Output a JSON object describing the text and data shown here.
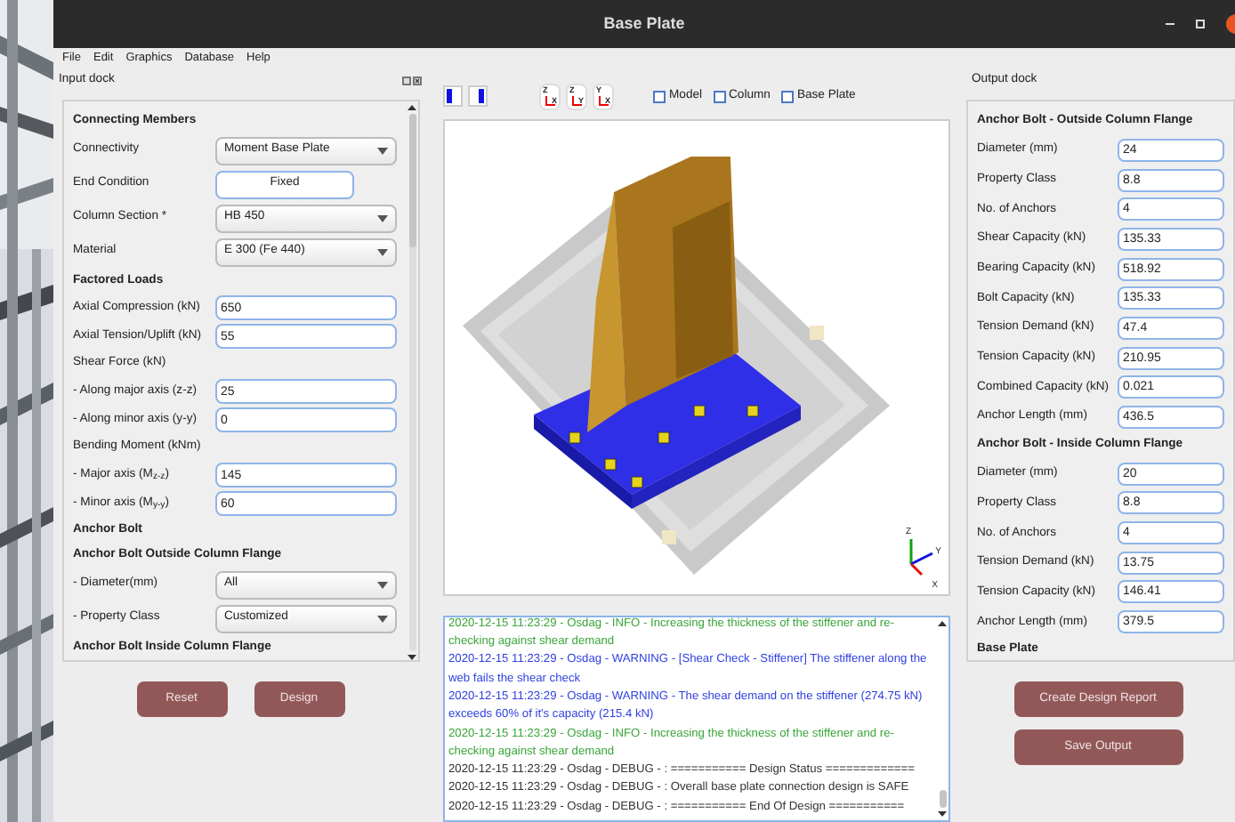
{
  "window": {
    "title": "Base Plate"
  },
  "menu": [
    "File",
    "Edit",
    "Graphics",
    "Database",
    "Help"
  ],
  "input_dock": {
    "title": "Input dock",
    "rows": [
      {
        "kind": "header",
        "label": "Connecting Members"
      },
      {
        "kind": "select",
        "label": "Connectivity",
        "value": "Moment Base Plate"
      },
      {
        "kind": "button",
        "label": "End Condition",
        "value": "Fixed"
      },
      {
        "kind": "select",
        "label": "Column Section *",
        "value": "HB 450"
      },
      {
        "kind": "select",
        "label": "Material",
        "value": "E 300 (Fe 440)"
      },
      {
        "kind": "header",
        "label": "Factored Loads"
      },
      {
        "kind": "input",
        "label": "Axial Compression (kN)",
        "value": "650"
      },
      {
        "kind": "input",
        "label": "Axial Tension/Uplift (kN)",
        "value": "55"
      },
      {
        "kind": "label",
        "label": "Shear Force (kN)"
      },
      {
        "kind": "input",
        "label": "- Along major axis (z-z)",
        "value": "25"
      },
      {
        "kind": "input",
        "label": "- Along minor axis (y-y)",
        "value": "0"
      },
      {
        "kind": "label",
        "label": "Bending Moment (kNm)"
      },
      {
        "kind": "input",
        "label": "- Major axis (M$_{z-z}$)",
        "value": "145"
      },
      {
        "kind": "input",
        "label": "- Minor axis (M$_{y-y}$)",
        "value": "60"
      },
      {
        "kind": "header",
        "label": "Anchor Bolt"
      },
      {
        "kind": "header",
        "label": "Anchor Bolt Outside Column Flange"
      },
      {
        "kind": "select",
        "label": "- Diameter(mm)",
        "value": "All"
      },
      {
        "kind": "select",
        "label": "- Property Class",
        "value": "Customized"
      },
      {
        "kind": "header",
        "label": "Anchor Bolt Inside Column Flange"
      }
    ],
    "buttons": [
      "Reset",
      "Design"
    ]
  },
  "toolbar": {
    "axis_views": [
      {
        "up": "Z",
        "right": "X"
      },
      {
        "up": "Z",
        "right": "Y"
      },
      {
        "up": "Y",
        "right": "X"
      }
    ],
    "checkboxes": [
      {
        "label": "Model",
        "checked": false
      },
      {
        "label": "Column",
        "checked": false
      },
      {
        "label": "Base Plate",
        "checked": false
      }
    ]
  },
  "axis_triad": {
    "z": "Z",
    "y": "Y",
    "x": "X"
  },
  "log": [
    {
      "kind": "info",
      "text": "2020-12-15 11:23:29 - Osdag - INFO - Increasing the thickness of the stiffener and re-checking against shear demand"
    },
    {
      "kind": "warning",
      "text": "2020-12-15 11:23:29 - Osdag - WARNING - [Shear Check - Stiffener] The stiffener along the web fails the shear check"
    },
    {
      "kind": "warning",
      "text": "2020-12-15 11:23:29 - Osdag - WARNING - The shear demand on the stiffener (274.75 kN) exceeds 60% of it's capacity (215.4 kN)"
    },
    {
      "kind": "info",
      "text": "2020-12-15 11:23:29 - Osdag - INFO - Increasing the thickness of the stiffener and re-checking against shear demand"
    },
    {
      "kind": "debug",
      "text": "2020-12-15 11:23:29 - Osdag - DEBUG - : =========== Design Status ============="
    },
    {
      "kind": "debug",
      "text": "2020-12-15 11:23:29 - Osdag - DEBUG - :       Overall base plate connection design is SAFE"
    },
    {
      "kind": "debug",
      "text": "2020-12-15 11:23:29 - Osdag - DEBUG - : =========== End Of Design ==========="
    }
  ],
  "output_dock": {
    "title": "Output dock",
    "rows": [
      {
        "kind": "header",
        "label": "Anchor Bolt - Outside Column Flange"
      },
      {
        "kind": "output",
        "label": "Diameter (mm)",
        "value": "24"
      },
      {
        "kind": "output",
        "label": "Property Class",
        "value": "8.8"
      },
      {
        "kind": "output",
        "label": "No. of Anchors",
        "value": "4"
      },
      {
        "kind": "output",
        "label": "Shear Capacity (kN)",
        "value": "135.33"
      },
      {
        "kind": "output",
        "label": "Bearing Capacity (kN)",
        "value": "518.92"
      },
      {
        "kind": "output",
        "label": "Bolt Capacity (kN)",
        "value": "135.33"
      },
      {
        "kind": "output",
        "label": "Tension Demand (kN)",
        "value": "47.4"
      },
      {
        "kind": "output",
        "label": "Tension Capacity (kN)",
        "value": "210.95"
      },
      {
        "kind": "output",
        "label": "Combined Capacity (kN)",
        "value": "0.021"
      },
      {
        "kind": "output",
        "label": "Anchor Length (mm)",
        "value": "436.5"
      },
      {
        "kind": "header",
        "label": "Anchor Bolt - Inside Column Flange"
      },
      {
        "kind": "output",
        "label": "Diameter (mm)",
        "value": "20"
      },
      {
        "kind": "output",
        "label": "Property Class",
        "value": "8.8"
      },
      {
        "kind": "output",
        "label": "No. of Anchors",
        "value": "4"
      },
      {
        "kind": "output",
        "label": "Tension Demand (kN)",
        "value": "13.75"
      },
      {
        "kind": "output",
        "label": "Tension Capacity (kN)",
        "value": "146.41"
      },
      {
        "kind": "output",
        "label": "Anchor Length (mm)",
        "value": "379.5"
      },
      {
        "kind": "header",
        "label": "Base Plate"
      }
    ],
    "buttons": [
      "Create Design Report",
      "Save Output"
    ]
  }
}
